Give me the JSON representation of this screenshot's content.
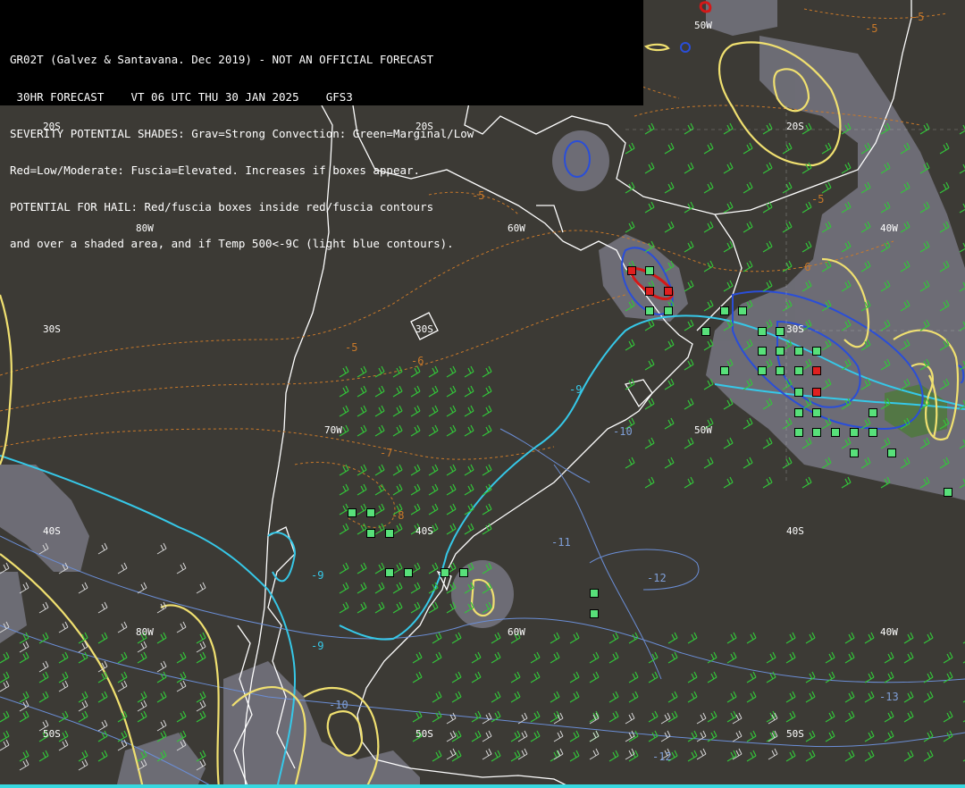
{
  "header": {
    "line1": "GR02T (Galvez & Santavana. Dec 2019) - NOT AN OFFICIAL FORECAST",
    "line2": " 30HR FORECAST    VT 06 UTC THU 30 JAN 2025    GFS3",
    "line3": "SEVERITY POTENTIAL SHADES: Grav=Strong Convection: Green=Marginal/Low",
    "line4": "Red=Low/Moderate: Fuscia=Elevated. Increases if boxes appear.",
    "line5": "POTENTIAL FOR HAIL: Red/fuscia boxes inside red/fuscia contours",
    "line6": "and over a shaded area, and if Temp 500<-9C (light blue contours)."
  },
  "grid_labels": {
    "g1": "20S",
    "g2": "20S",
    "g3": "20S",
    "g4": "80W",
    "g5": "60W",
    "g6": "40W",
    "g7": "30S",
    "g8": "30S",
    "g9": "30S",
    "g10": "70W",
    "g11": "50W",
    "g12": "40S",
    "g13": "40S",
    "g14": "40S",
    "g15": "80W",
    "g16": "60W",
    "g17": "40W",
    "g18": "50S",
    "g19": "50S",
    "g20": "50S",
    "g21": "50W"
  },
  "contour_labels": {
    "o1": "-5",
    "o2": "-5",
    "o3": "-5",
    "o4": "-5",
    "o5": "-6",
    "o6": "-6",
    "o7": "-7",
    "o8": "-8",
    "c1": "-9",
    "c2": "-9",
    "c3": "-9",
    "b1": "-10",
    "b2": "-11",
    "b3": "-12",
    "b4": "-12",
    "b5": "-13",
    "b6": "-10"
  },
  "colors": {
    "background": "#3c3a35",
    "land_outline": "#ffffff",
    "shade_gray": "#7a7a84",
    "shade_green": "#4c7a3a",
    "cyan_contour": "#36c8e8",
    "blue_contour": "#2a4ed8",
    "yellow_contour": "#f0e070",
    "orange_contour": "#c9792a",
    "wind_barb": "#33c43a",
    "box_green": "#58e07a",
    "box_red": "#e02020"
  },
  "icons": {
    "hail_boxes": "square-marker",
    "wind_barbs": "wind-barb"
  }
}
